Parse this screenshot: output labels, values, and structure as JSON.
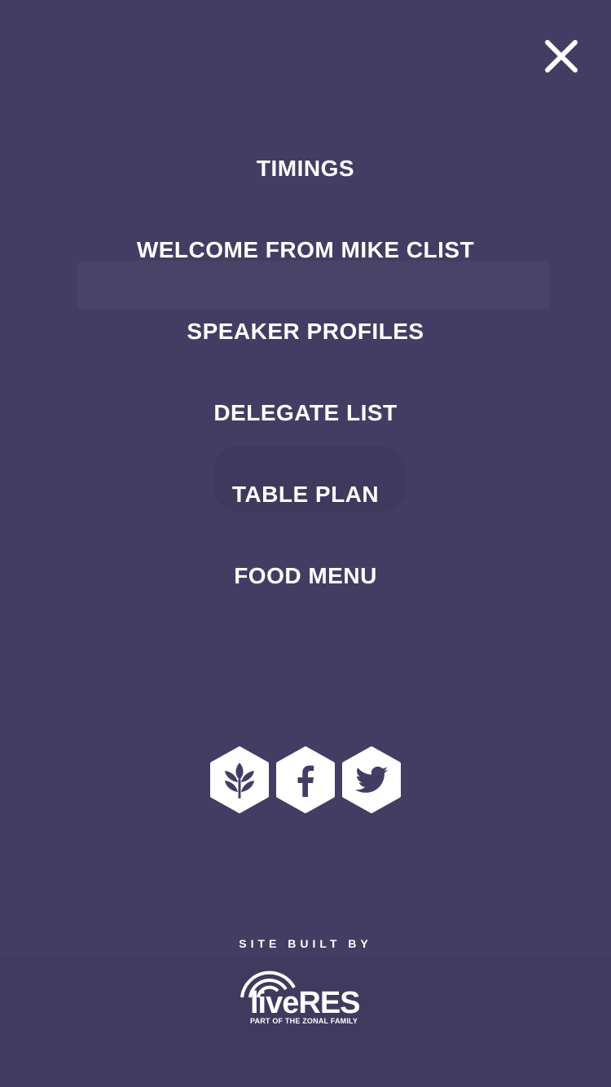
{
  "close": {
    "icon": "close-icon"
  },
  "menu": {
    "items": [
      {
        "label": "TIMINGS"
      },
      {
        "label": "WELCOME FROM MIKE CLIST"
      },
      {
        "label": "SPEAKER PROFILES"
      },
      {
        "label": "DELEGATE LIST"
      },
      {
        "label": "TABLE PLAN"
      },
      {
        "label": "FOOD MENU"
      }
    ]
  },
  "social": {
    "items": [
      {
        "icon": "wheat-icon"
      },
      {
        "icon": "facebook-icon"
      },
      {
        "icon": "twitter-icon"
      }
    ]
  },
  "footer": {
    "built_by": "SITE BUILT BY",
    "logo_text": "liveRES",
    "logo_tagline": "PART OF THE ZONAL FAMILY"
  },
  "colors": {
    "background": "#433d63",
    "text": "#ffffff"
  }
}
